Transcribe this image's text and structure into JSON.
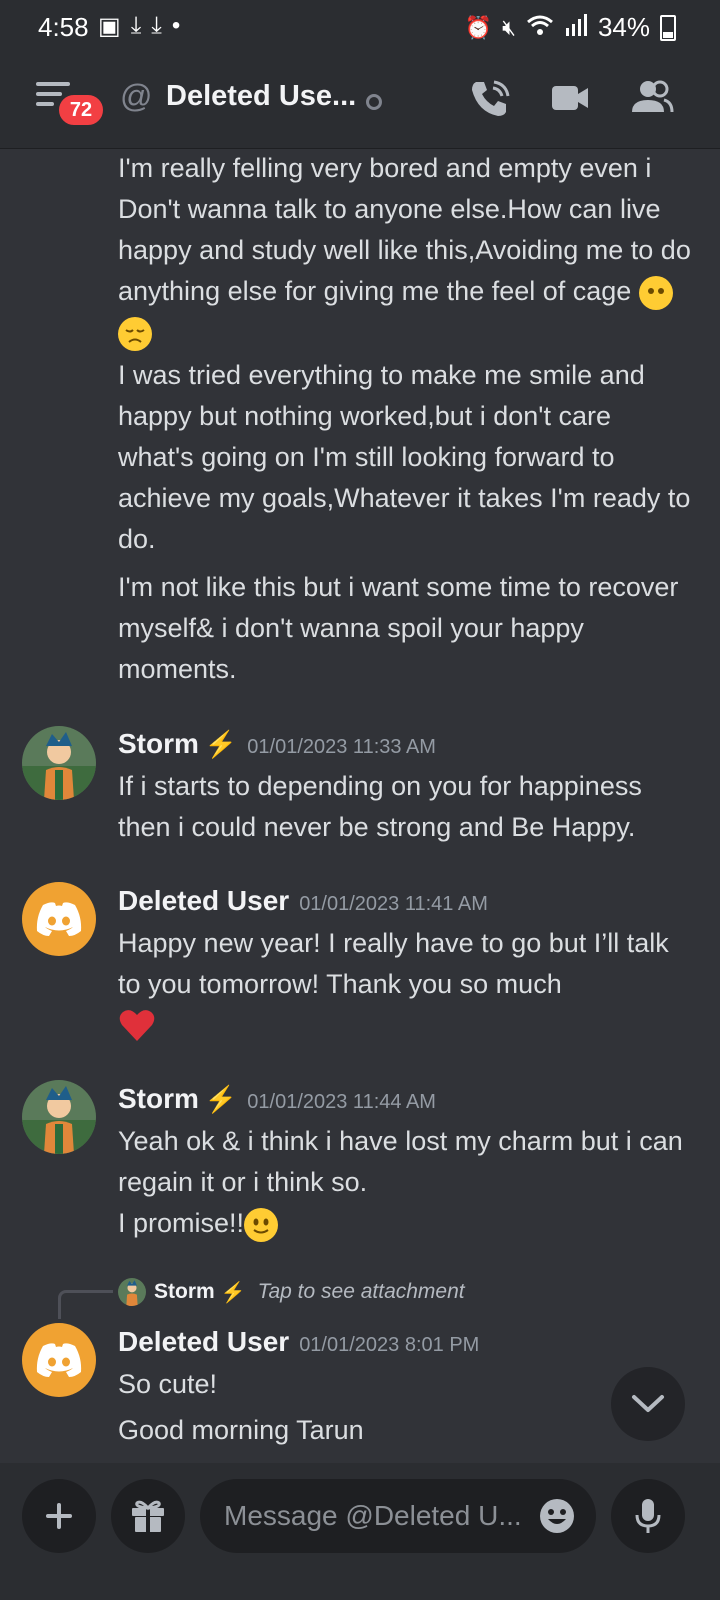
{
  "status_bar": {
    "time": "4:58",
    "battery": "34%"
  },
  "header": {
    "badge_count": "72",
    "channel_title": "Deleted Use..."
  },
  "messages": {
    "cont_1": "I'm really felling very bored and empty even i Don't wanna talk to anyone else.How can live happy and study well like this,Avoiding me to do anything else for giving me the feel of cage",
    "cont_2": "I was tried everything to make me smile and happy but nothing worked,but i don't care what's going on I'm still looking forward to achieve my goals,Whatever it takes I'm ready to do.",
    "cont_3": "I'm not like this but i want some time to recover myself& i don't wanna spoil your happy moments.",
    "m1_user": "Storm",
    "m1_time": "01/01/2023 11:33 AM",
    "m1_text": "If i starts to depending on you for happiness then i could never be strong and Be Happy.",
    "m2_user": "Deleted User",
    "m2_time": "01/01/2023 11:41 AM",
    "m2_text": "Happy new year! I really have to go but I’ll talk to you tomorrow! Thank you so much",
    "m3_user": "Storm",
    "m3_time": "01/01/2023 11:44 AM",
    "m3_text_1": "Yeah ok & i think i have lost my charm but i can regain it or i think so.",
    "m3_text_2": "I promise!!",
    "reply_user": "Storm",
    "reply_text": "Tap to see attachment",
    "m4_user": "Deleted User",
    "m4_time": "01/01/2023 8:01 PM",
    "m4_text_1": "So cute!",
    "m4_text_2": "Good morning Tarun"
  },
  "composer": {
    "placeholder": "Message @Deleted U..."
  },
  "colors": {
    "background": "#313338",
    "header": "#2b2d31",
    "discord_avatar": "#f0a232",
    "badge": "#f23f43"
  }
}
